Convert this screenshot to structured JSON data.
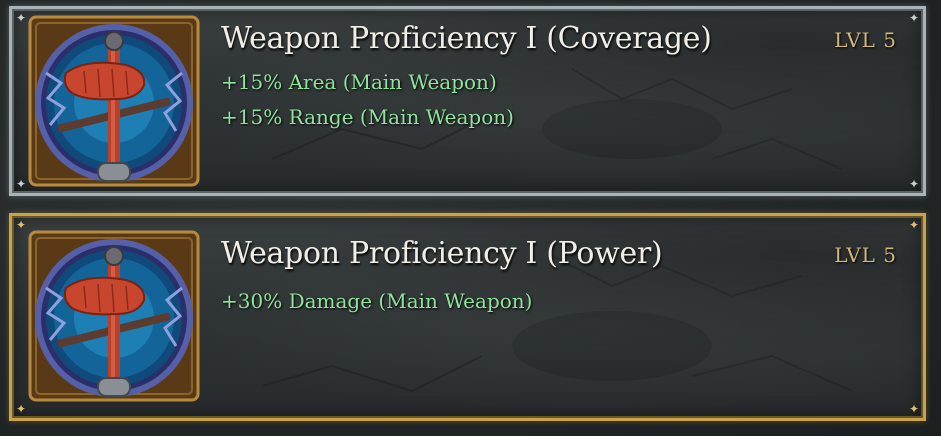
{
  "upgrades": [
    {
      "title": "Weapon Proficiency I (Coverage)",
      "level": "LVL 5",
      "bonuses": [
        "+15% Area (Main Weapon)",
        "+15% Range (Main Weapon)"
      ],
      "frame": "silver",
      "icon": "hand-gripping-sword-icon"
    },
    {
      "title": "Weapon Proficiency I (Power)",
      "level": "LVL 5",
      "bonuses": [
        "+30% Damage (Main Weapon)"
      ],
      "frame": "gold",
      "icon": "hand-gripping-sword-icon"
    }
  ],
  "colors": {
    "title": "#f1eee6",
    "bonus": "#8fe39c",
    "level": "#d3b87c",
    "silver_frame": "#a9b2b5",
    "gold_frame": "#c9a34a"
  }
}
